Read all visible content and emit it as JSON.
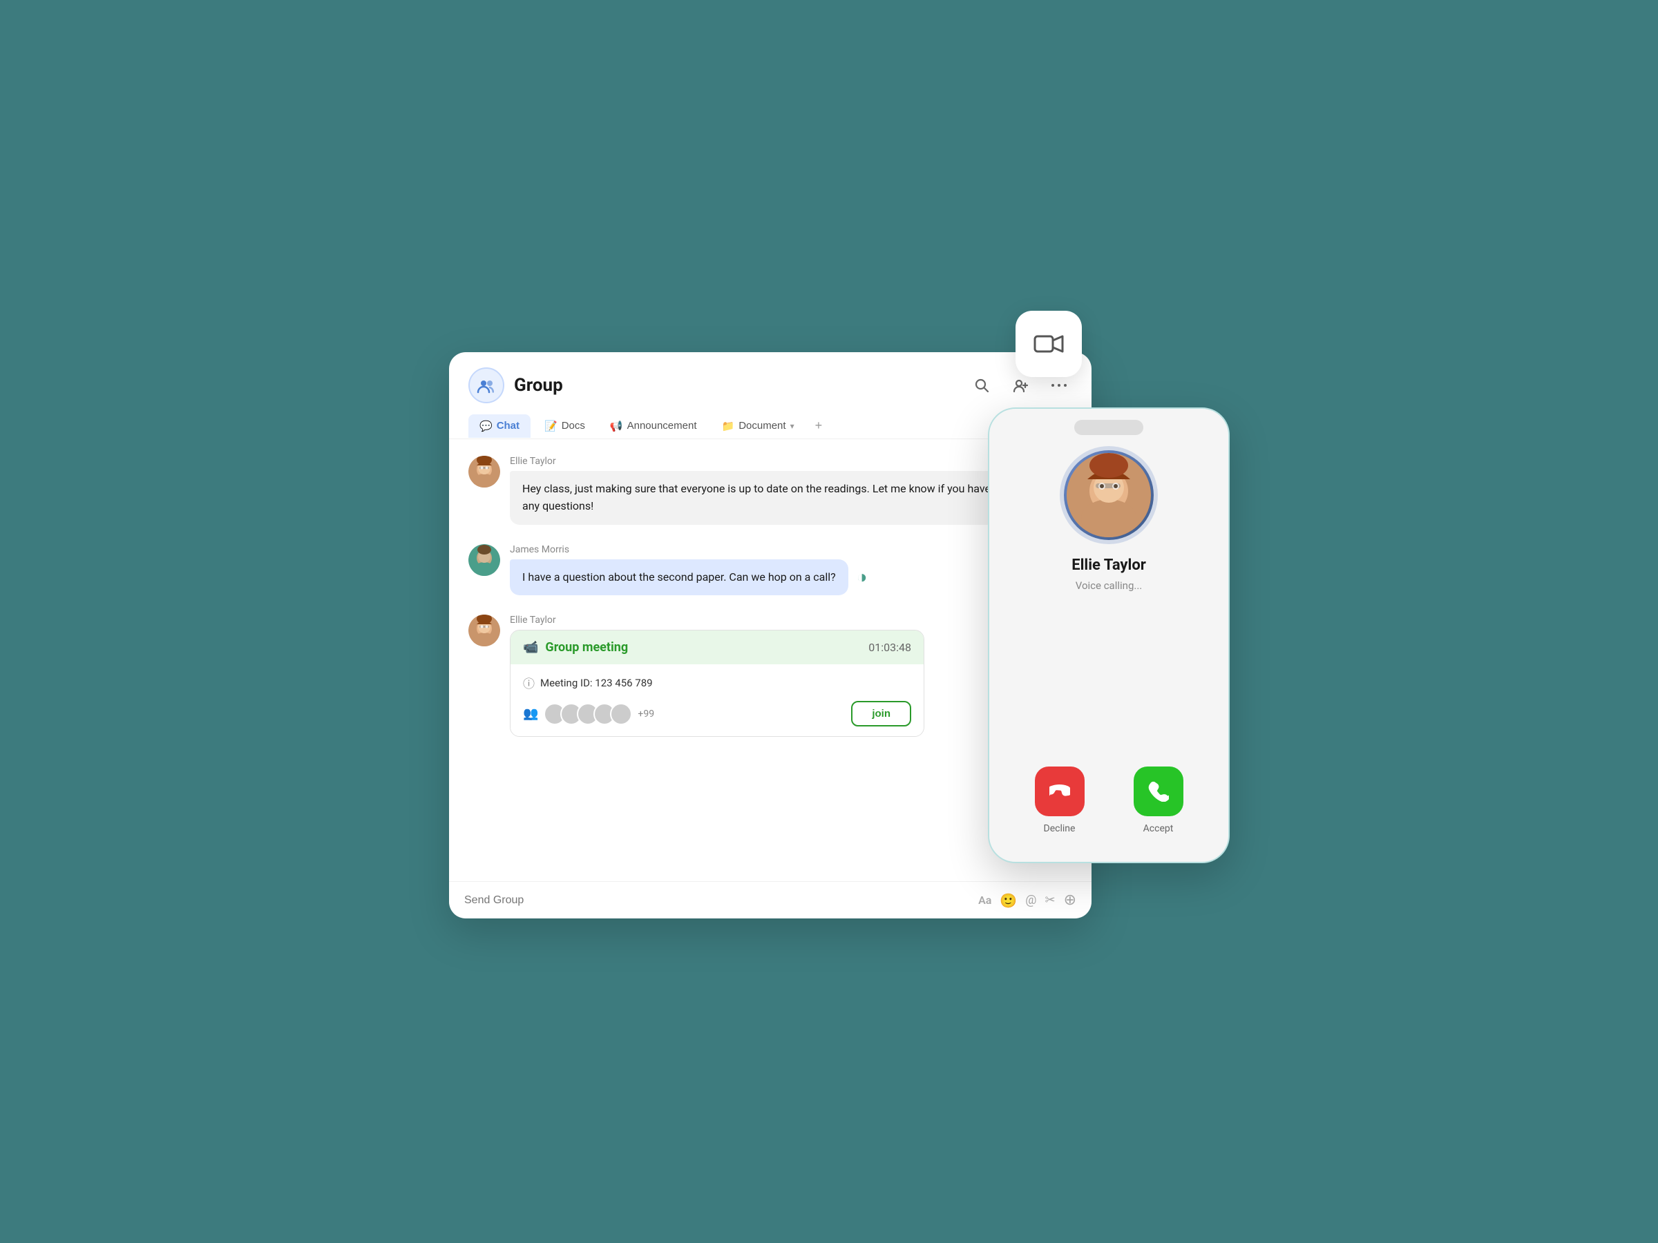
{
  "scene": {
    "background_color": "#3d7b7e"
  },
  "chat_window": {
    "group_title": "Group",
    "tabs": [
      {
        "id": "chat",
        "label": "Chat",
        "icon": "💬",
        "active": true
      },
      {
        "id": "docs",
        "label": "Docs",
        "icon": "📝",
        "active": false
      },
      {
        "id": "announcement",
        "label": "Announcement",
        "icon": "📢",
        "active": false
      },
      {
        "id": "document",
        "label": "Document",
        "icon": "📁",
        "active": false
      }
    ],
    "messages": [
      {
        "id": 1,
        "sender": "Ellie Taylor",
        "avatar_type": "ellie",
        "text": "Hey class, just making sure that everyone is up to date on the readings. Let me know if you have any questions!",
        "style": "gray"
      },
      {
        "id": 2,
        "sender": "James Morris",
        "avatar_type": "james",
        "text": "I have a question about the second paper. Can we hop on a call?",
        "style": "blue"
      },
      {
        "id": 3,
        "sender": "Ellie Taylor",
        "avatar_type": "ellie",
        "text": null,
        "style": "meeting_card"
      }
    ],
    "meeting_card": {
      "title": "Group meeting",
      "video_icon": "📹",
      "timer": "01:03:48",
      "meeting_id_label": "Meeting ID: 123 456 789",
      "more_count": "+99",
      "join_label": "join"
    },
    "input_placeholder": "Send Group",
    "input_icons": [
      "Aa",
      "🙂",
      "@",
      "✂️",
      "⊕"
    ]
  },
  "video_fab": {
    "icon": "📹"
  },
  "phone_overlay": {
    "caller_name": "Ellie Taylor",
    "caller_status": "Voice calling...",
    "decline_label": "Decline",
    "accept_label": "Accept"
  }
}
